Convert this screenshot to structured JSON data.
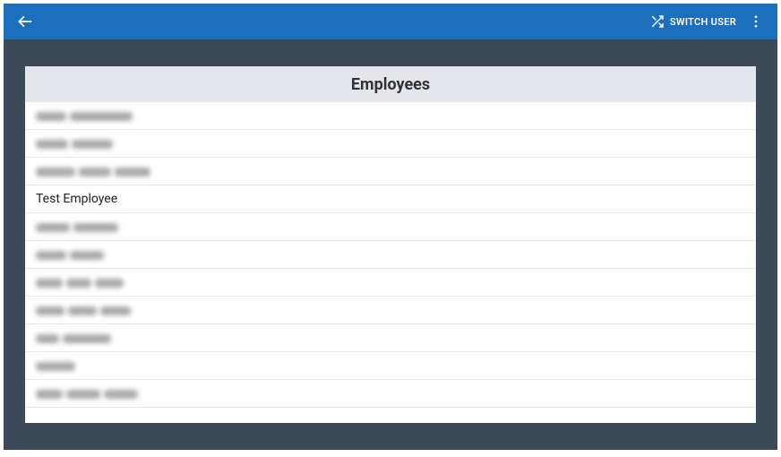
{
  "toolbar": {
    "switch_user_label": "SWITCH USER"
  },
  "card": {
    "title": "Employees"
  },
  "employees": [
    {
      "name": "",
      "blurred": true,
      "chunks": [
        34,
        70
      ]
    },
    {
      "name": "",
      "blurred": true,
      "chunks": [
        36,
        46
      ]
    },
    {
      "name": "",
      "blurred": true,
      "chunks": [
        44,
        36,
        40
      ]
    },
    {
      "name": "Test Employee",
      "blurred": false
    },
    {
      "name": "",
      "blurred": true,
      "chunks": [
        38,
        50
      ]
    },
    {
      "name": "",
      "blurred": true,
      "chunks": [
        34,
        38
      ]
    },
    {
      "name": "",
      "blurred": true,
      "chunks": [
        30,
        28,
        32
      ]
    },
    {
      "name": "",
      "blurred": true,
      "chunks": [
        32,
        32,
        34
      ]
    },
    {
      "name": "",
      "blurred": true,
      "chunks": [
        26,
        54
      ]
    },
    {
      "name": "",
      "blurred": true,
      "chunks": [
        44
      ]
    },
    {
      "name": "",
      "blurred": true,
      "chunks": [
        30,
        38,
        38
      ]
    }
  ]
}
